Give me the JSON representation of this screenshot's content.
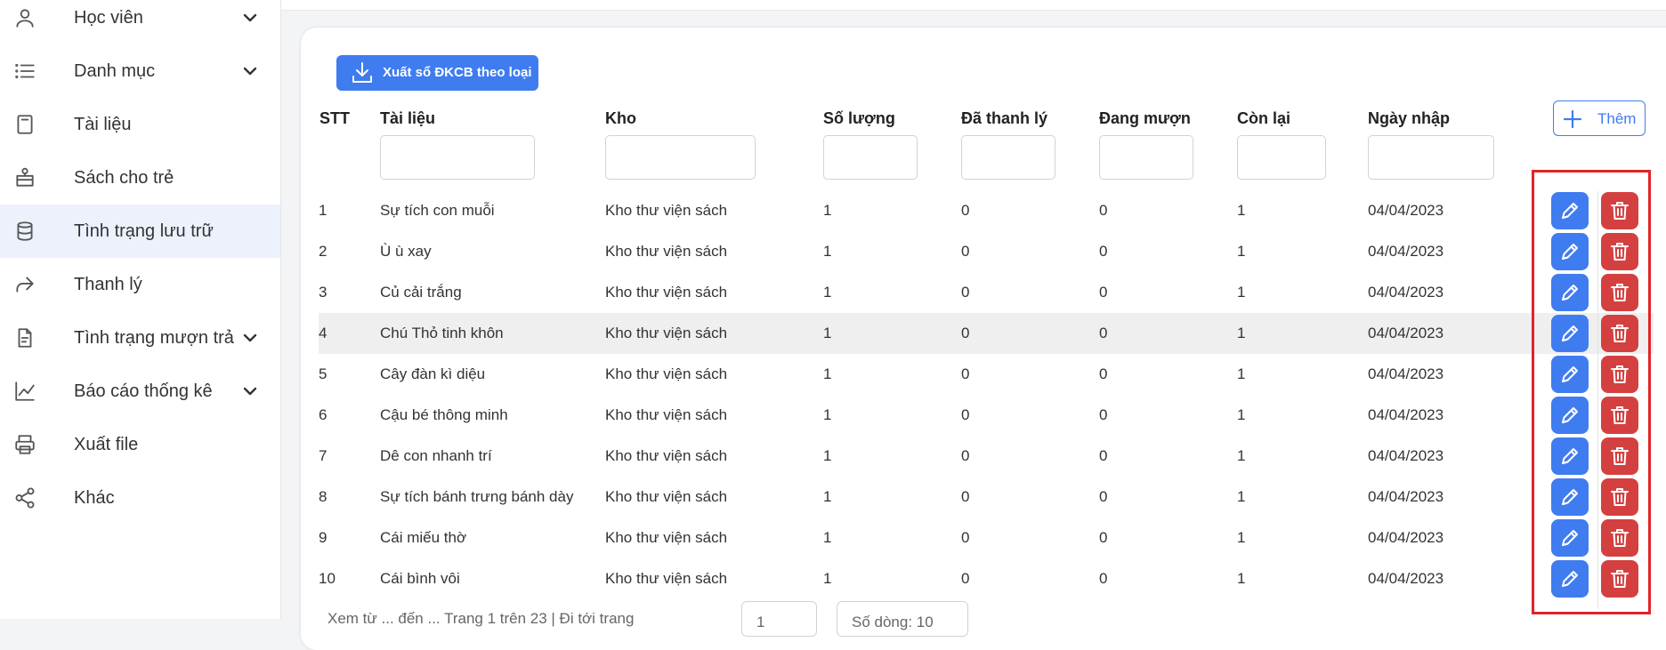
{
  "sidebar": {
    "items": [
      {
        "label": "Học viên",
        "icon": "user-icon",
        "has_chevron": true
      },
      {
        "label": "Danh mục",
        "icon": "list-icon",
        "has_chevron": true
      },
      {
        "label": "Tài liệu",
        "icon": "book-icon",
        "has_chevron": false
      },
      {
        "label": "Sách cho trẻ",
        "icon": "baby-icon",
        "has_chevron": false
      },
      {
        "label": "Tình trạng lưu trữ",
        "icon": "database-icon",
        "has_chevron": false,
        "active": true
      },
      {
        "label": "Thanh lý",
        "icon": "share-arrow-icon",
        "has_chevron": false
      },
      {
        "label": "Tình trạng mượn trả",
        "icon": "document-icon",
        "has_chevron": true
      },
      {
        "label": "Báo cáo thống kê",
        "icon": "chart-icon",
        "has_chevron": true
      },
      {
        "label": "Xuất file",
        "icon": "printer-icon",
        "has_chevron": false
      },
      {
        "label": "Khác",
        "icon": "share-nodes-icon",
        "has_chevron": false
      }
    ]
  },
  "toolbar": {
    "export_label": "Xuất sổ ĐKCB theo loại",
    "add_label": "Thêm"
  },
  "table": {
    "columns": [
      "STT",
      "Tài liệu",
      "Kho",
      "Số lượng",
      "Đã thanh lý",
      "Đang mượn",
      "Còn lại",
      "Ngày nhập"
    ],
    "rows": [
      [
        "1",
        "Sự tích con muỗi",
        "Kho thư viện sách",
        "1",
        "0",
        "0",
        "1",
        "04/04/2023"
      ],
      [
        "2",
        "Ù ù xay",
        "Kho thư viện sách",
        "1",
        "0",
        "0",
        "1",
        "04/04/2023"
      ],
      [
        "3",
        "Củ cải trắng",
        "Kho thư viện sách",
        "1",
        "0",
        "0",
        "1",
        "04/04/2023"
      ],
      [
        "4",
        "Chú Thỏ tinh khôn",
        "Kho thư viện sách",
        "1",
        "0",
        "0",
        "1",
        "04/04/2023"
      ],
      [
        "5",
        "Cây đàn kì diệu",
        "Kho thư viện sách",
        "1",
        "0",
        "0",
        "1",
        "04/04/2023"
      ],
      [
        "6",
        "Cậu bé thông minh",
        "Kho thư viện sách",
        "1",
        "0",
        "0",
        "1",
        "04/04/2023"
      ],
      [
        "7",
        "Dê con nhanh trí",
        "Kho thư viện sách",
        "1",
        "0",
        "0",
        "1",
        "04/04/2023"
      ],
      [
        "8",
        "Sự tích bánh trưng bánh dày",
        "Kho thư viện sách",
        "1",
        "0",
        "0",
        "1",
        "04/04/2023"
      ],
      [
        "9",
        "Cái miếu thờ",
        "Kho thư viện sách",
        "1",
        "0",
        "0",
        "1",
        "04/04/2023"
      ],
      [
        "10",
        "Cái bình vôi",
        "Kho thư viện sách",
        "1",
        "0",
        "0",
        "1",
        "04/04/2023"
      ]
    ],
    "highlighted_row": 4
  },
  "footer": {
    "summary": "Xem từ ... đến ... Trang 1 trên 23 | Đi tới trang",
    "page_value": "1",
    "rows_label": "Số dòng: 10"
  },
  "colors": {
    "primary": "#3f7cf0",
    "danger": "#d44040",
    "highlight_box": "#e0242a",
    "active_nav_bg": "#ecf1fb"
  }
}
